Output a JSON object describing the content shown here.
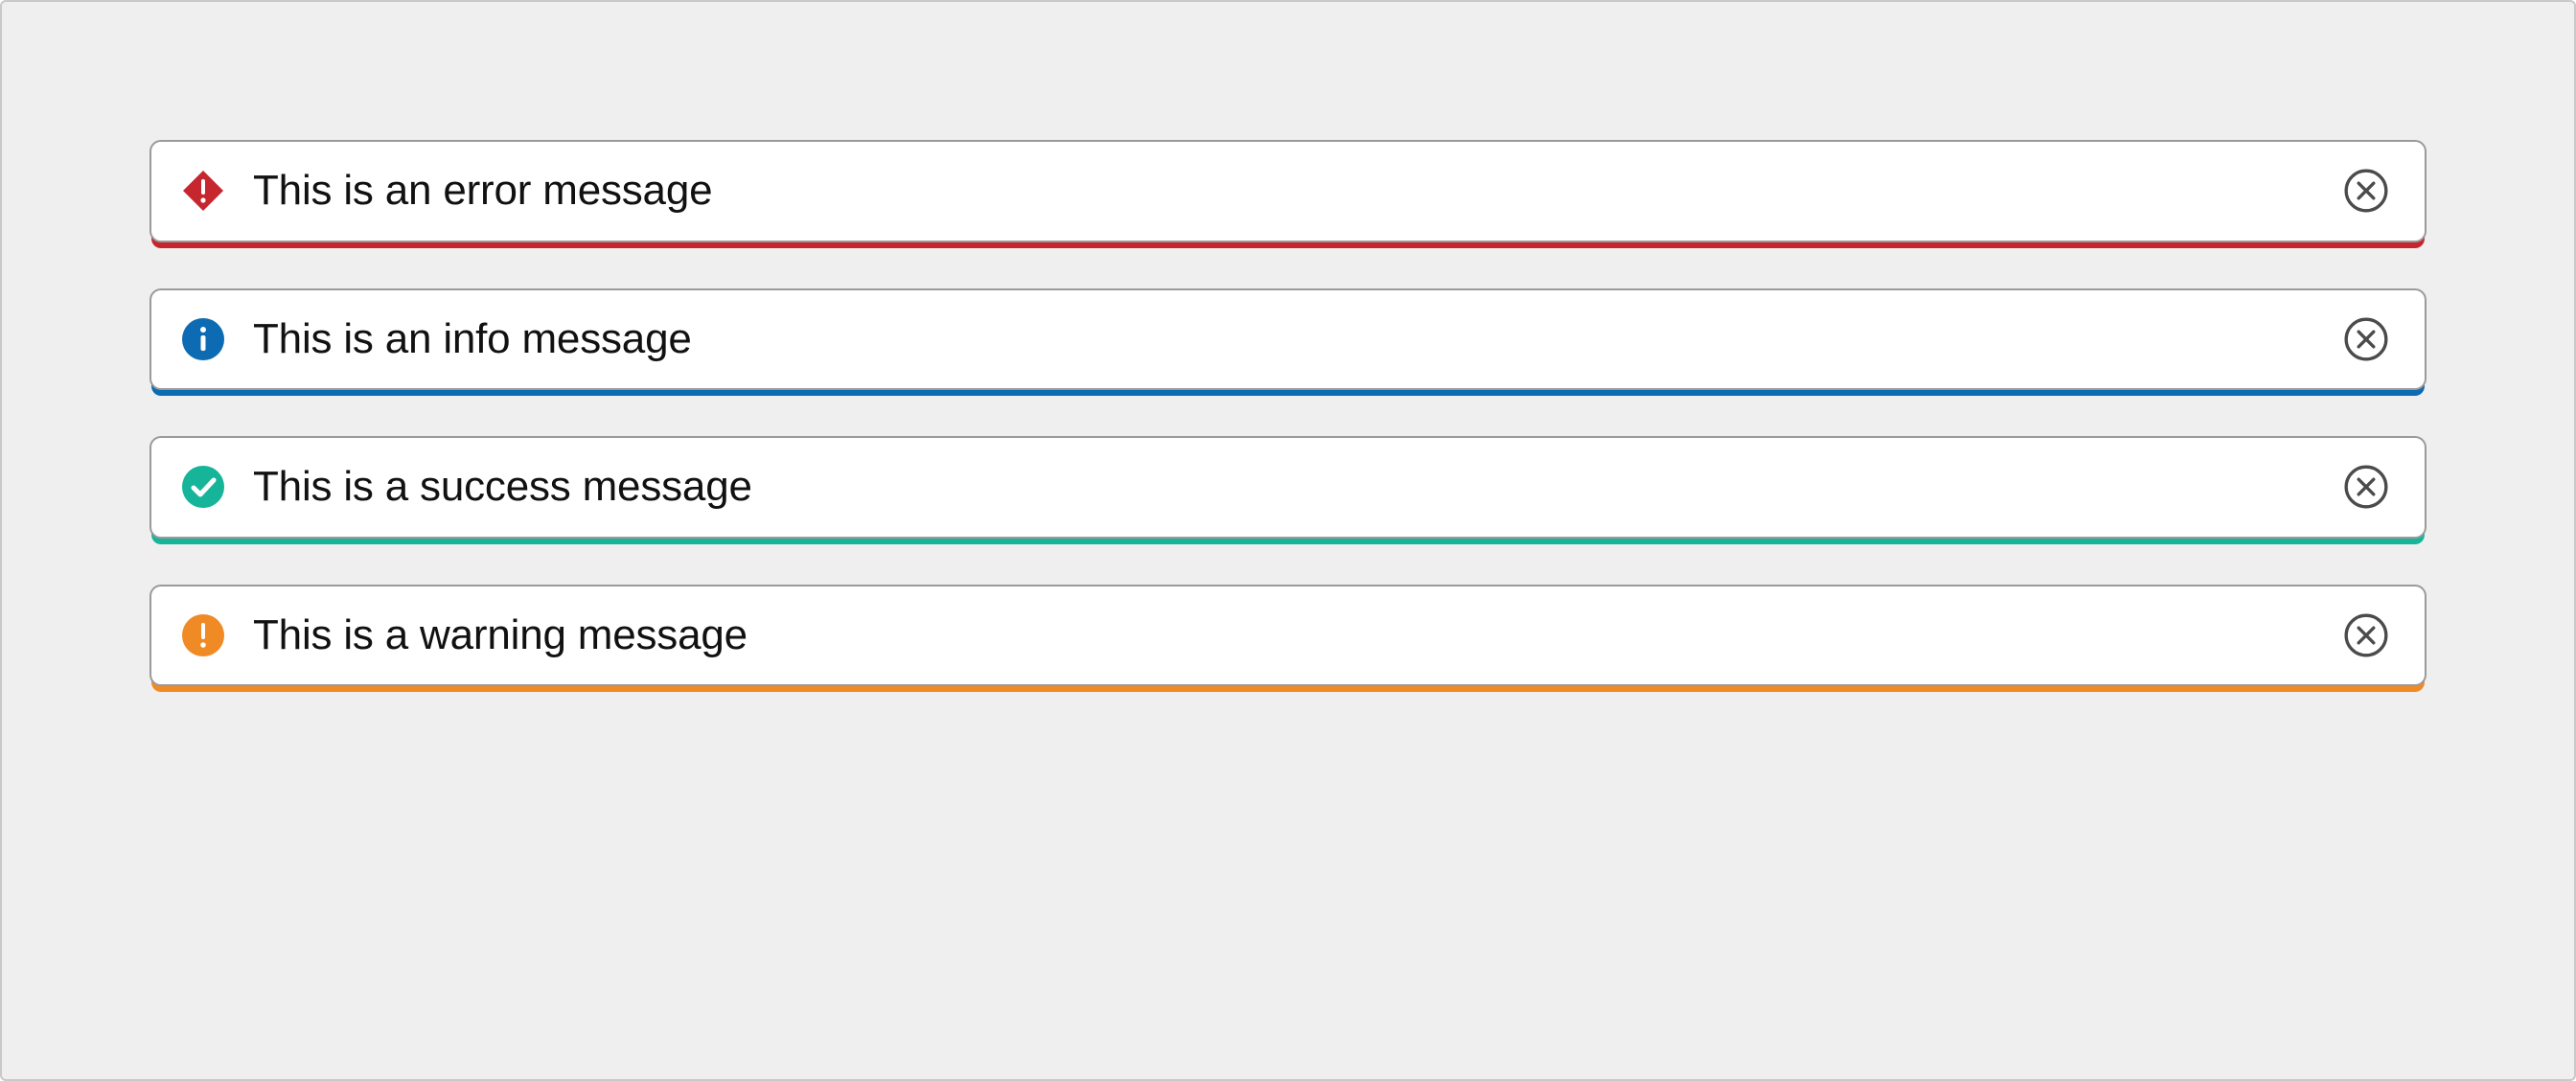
{
  "alerts": [
    {
      "type": "error",
      "icon": "error-icon",
      "text": "This is an error message",
      "accent": "#c6262e"
    },
    {
      "type": "info",
      "icon": "info-icon",
      "text": "This is an info message",
      "accent": "#0d6bb3"
    },
    {
      "type": "success",
      "icon": "success-icon",
      "text": "This is a success message",
      "accent": "#16b59a"
    },
    {
      "type": "warning",
      "icon": "warning-icon",
      "text": "This is a warning message",
      "accent": "#f08a24"
    }
  ],
  "close_label": "Close"
}
